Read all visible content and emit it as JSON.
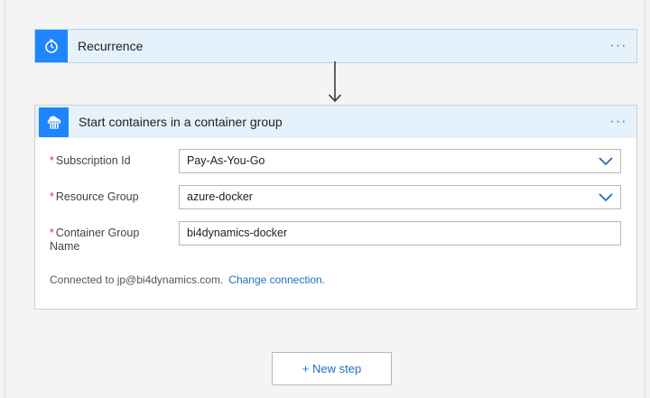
{
  "steps": [
    {
      "title": "Recurrence",
      "icon": "stopwatch-icon",
      "more_label": "···"
    },
    {
      "title": "Start containers in a container group",
      "icon": "container-instance-icon",
      "more_label": "···",
      "fields": [
        {
          "label": "Subscription Id",
          "required": true,
          "value": "Pay-As-You-Go",
          "type": "dropdown"
        },
        {
          "label": "Resource Group",
          "required": true,
          "value": "azure-docker",
          "type": "dropdown"
        },
        {
          "label": "Container Group Name",
          "required": true,
          "value": "bi4dynamics-docker",
          "type": "text"
        }
      ],
      "connection_text": "Connected to jp@bi4dynamics.com.",
      "change_connection_label": "Change connection."
    }
  ],
  "new_step_label": "+ New step",
  "required_marker": "*",
  "colors": {
    "accent": "#1f85ff",
    "header_bg": "#e5f1fb",
    "link": "#1f6fc4",
    "required": "#d43b3b"
  }
}
